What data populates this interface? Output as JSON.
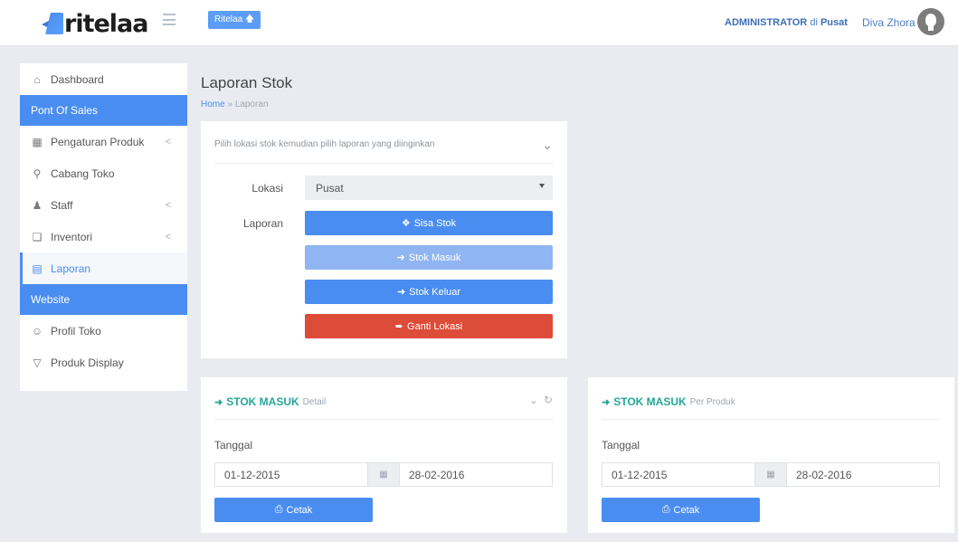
{
  "header": {
    "logo_text": "ritelaa",
    "brand_button": "Ritelaa",
    "admin_role": "ADMINISTRATOR",
    "admin_sep": "di",
    "admin_location": "Pusat",
    "user_name": "Diva Zhora"
  },
  "sidebar": {
    "items": [
      {
        "label": "Dashboard",
        "icon": "home-icon"
      },
      {
        "label": "Pont Of Sales",
        "type": "header"
      },
      {
        "label": "Pengaturan Produk",
        "icon": "briefcase-icon",
        "chevron": "<"
      },
      {
        "label": "Cabang Toko",
        "icon": "map-marker-icon"
      },
      {
        "label": "Staff",
        "icon": "users-icon",
        "chevron": "<"
      },
      {
        "label": "Inventori",
        "icon": "files-icon",
        "chevron": "<"
      },
      {
        "label": "Laporan",
        "icon": "document-icon",
        "active": true
      },
      {
        "label": "Website",
        "type": "header"
      },
      {
        "label": "Profil Toko",
        "icon": "user-icon"
      },
      {
        "label": "Produk Display",
        "icon": "cart-icon"
      }
    ]
  },
  "page": {
    "title": "Laporan Stok",
    "breadcrumb_home": "Home",
    "breadcrumb_sep": "»",
    "breadcrumb_current": "Laporan"
  },
  "report_panel": {
    "hint": "Pilih lokasi stok kemudian pilih laporan yang diinginkan",
    "lokasi_label": "Lokasi",
    "lokasi_value": "Pusat",
    "laporan_label": "Laporan",
    "buttons": {
      "sisa_stok": "Sisa Stok",
      "stok_masuk": "Stok Masuk",
      "stok_keluar": "Stok Keluar",
      "ganti_lokasi": "Ganti Lokasi"
    }
  },
  "stok_masuk_detail": {
    "title": "STOK MASUK",
    "subtitle": "Detail",
    "tanggal_label": "Tanggal",
    "date_from": "01-12-2015",
    "date_to": "28-02-2016",
    "print_label": "Cetak"
  },
  "stok_masuk_produk": {
    "title": "STOK MASUK",
    "subtitle": "Per Produk",
    "tanggal_label": "Tanggal",
    "date_from": "01-12-2015",
    "date_to": "28-02-2016",
    "print_label": "Cetak"
  },
  "colors": {
    "primary": "#4a8df0",
    "danger": "#dd4b39",
    "accent_teal": "#26a69a"
  }
}
